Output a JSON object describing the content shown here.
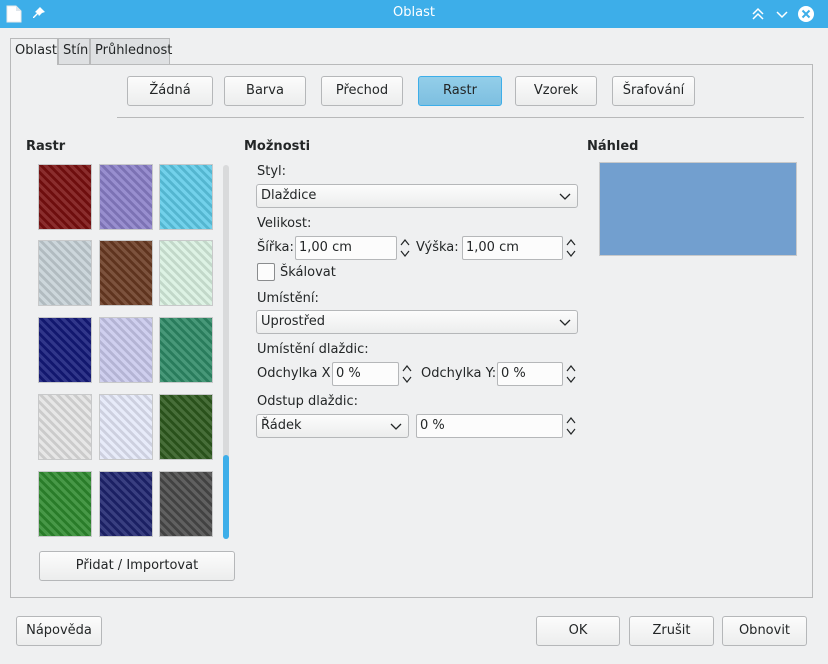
{
  "window": {
    "title": "Oblast"
  },
  "tabs": [
    {
      "label": "Oblast"
    },
    {
      "label": "Stín"
    },
    {
      "label": "Průhlednost"
    }
  ],
  "fill_types": [
    {
      "label": "Žádná"
    },
    {
      "label": "Barva"
    },
    {
      "label": "Přechod"
    },
    {
      "label": "Rastr",
      "selected": true
    },
    {
      "label": "Vzorek"
    },
    {
      "label": "Šrafování"
    }
  ],
  "bitmap": {
    "heading": "Rastr",
    "add_import_label": "Přidat / Importovat",
    "tile_colors": [
      "#7a1010",
      "#8a7fc8",
      "#5ecbe8",
      "#c5d0d6",
      "#6a3a22",
      "#d8f0e0",
      "#141a7a",
      "#c8c8ec",
      "#2e8a66",
      "#e2e2e2",
      "#e4e8f8",
      "#2e5a1e",
      "#2e8a2e",
      "#1e246e",
      "#4a4a4a"
    ]
  },
  "options": {
    "heading": "Možnosti",
    "style_label": "Styl:",
    "style_value": "Dlaždice",
    "size_label": "Velikost:",
    "width_label": "Šířka:",
    "width_value": "1,00 cm",
    "height_label": "Výška:",
    "height_value": "1,00 cm",
    "scale_label": "Škálovat",
    "scale_checked": false,
    "position_label": "Umístění:",
    "position_value": "Uprostřed",
    "tile_position_label": "Umístění dlaždic:",
    "offset_x_label": "Odchylka X:",
    "offset_x_value": "0 %",
    "offset_y_label": "Odchylka Y:",
    "offset_y_value": "0 %",
    "tile_offset_label": "Odstup dlaždic:",
    "tile_offset_mode": "Řádek",
    "tile_offset_value": "0 %"
  },
  "preview": {
    "heading": "Náhled",
    "color": "#729fcf"
  },
  "footer": {
    "help_label": "Nápověda",
    "ok_label": "OK",
    "cancel_label": "Zrušit",
    "reset_label": "Obnovit"
  },
  "colors": {
    "accent": "#3daee9",
    "selected_button": "#93cee9"
  }
}
